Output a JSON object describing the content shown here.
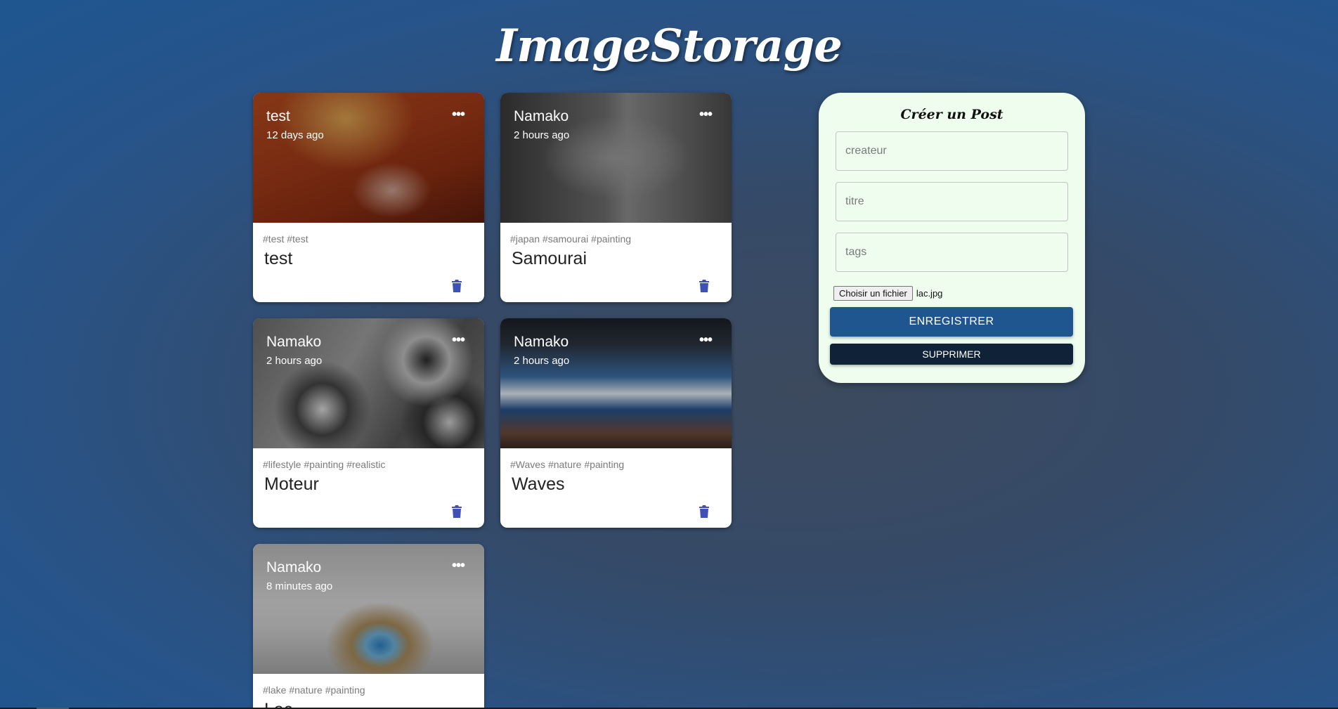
{
  "app": {
    "title": "ImageStorage"
  },
  "posts": [
    {
      "creator": "test",
      "time": "12 days ago",
      "tags": "#test #test",
      "title": "test"
    },
    {
      "creator": "Namako",
      "time": "2 hours ago",
      "tags": "#japan #samourai #painting",
      "title": "Samourai"
    },
    {
      "creator": "Namako",
      "time": "2 hours ago",
      "tags": "#lifestyle #painting #realistic",
      "title": "Moteur"
    },
    {
      "creator": "Namako",
      "time": "2 hours ago",
      "tags": "#Waves #nature #painting",
      "title": "Waves"
    },
    {
      "creator": "Namako",
      "time": "8 minutes ago",
      "tags": "#lake #nature #painting",
      "title": "Lac"
    }
  ],
  "card_more_label": "•••",
  "form": {
    "heading": "Créer un Post",
    "creator_placeholder": "createur",
    "title_placeholder": "titre",
    "tags_placeholder": "tags",
    "file_button": "Choisir un fichier",
    "file_name": "lac.jpg",
    "save_label": "ENREGISTRER",
    "clear_label": "SUPPRIMER"
  },
  "colors": {
    "accent": "#1f5690",
    "dark_button": "#0f2238",
    "panel": "#effdef",
    "delete_icon": "#3f51b5"
  }
}
